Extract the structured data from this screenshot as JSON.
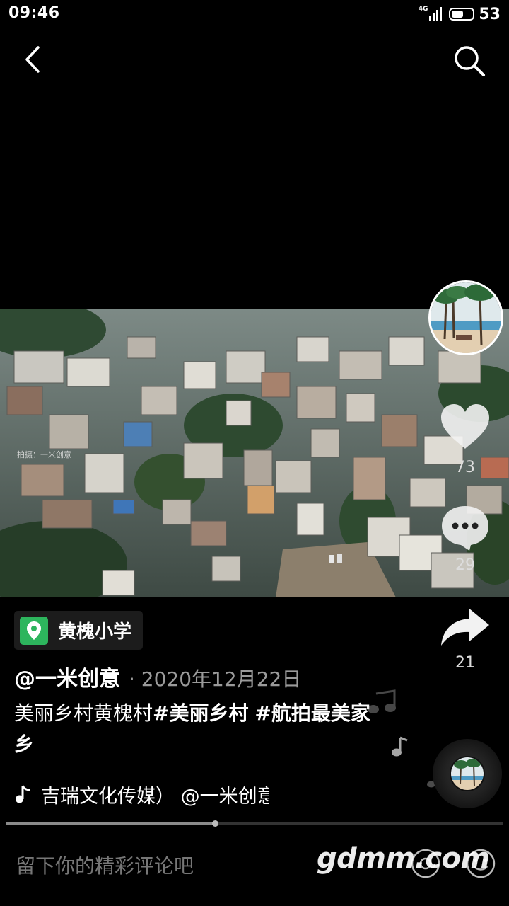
{
  "status_bar": {
    "time": "09:46",
    "network": "4G",
    "battery": "53"
  },
  "nav": {
    "back_icon": "chevron-left-icon",
    "search_icon": "search-icon"
  },
  "video": {
    "watermark": "拍摄：一米创意"
  },
  "actions": {
    "likes": "73",
    "comments": "29",
    "shares": "21"
  },
  "location": {
    "name": "黄槐小学",
    "icon": "location-pin-icon",
    "icon_color": "#2db55d"
  },
  "post": {
    "author": "@一米创意",
    "date": "· 2020年12月22日",
    "caption_plain": "美丽乡村黄槐村",
    "caption_tag1": "#美丽乡村",
    "caption_tag2": "#航拍最美家乡"
  },
  "music": {
    "text": "吉瑞文化传媒）    @一米创意"
  },
  "playback": {
    "progress": 0.42
  },
  "comment_bar": {
    "placeholder": "留下你的精彩评论吧",
    "watermark": "gdmm.com"
  }
}
